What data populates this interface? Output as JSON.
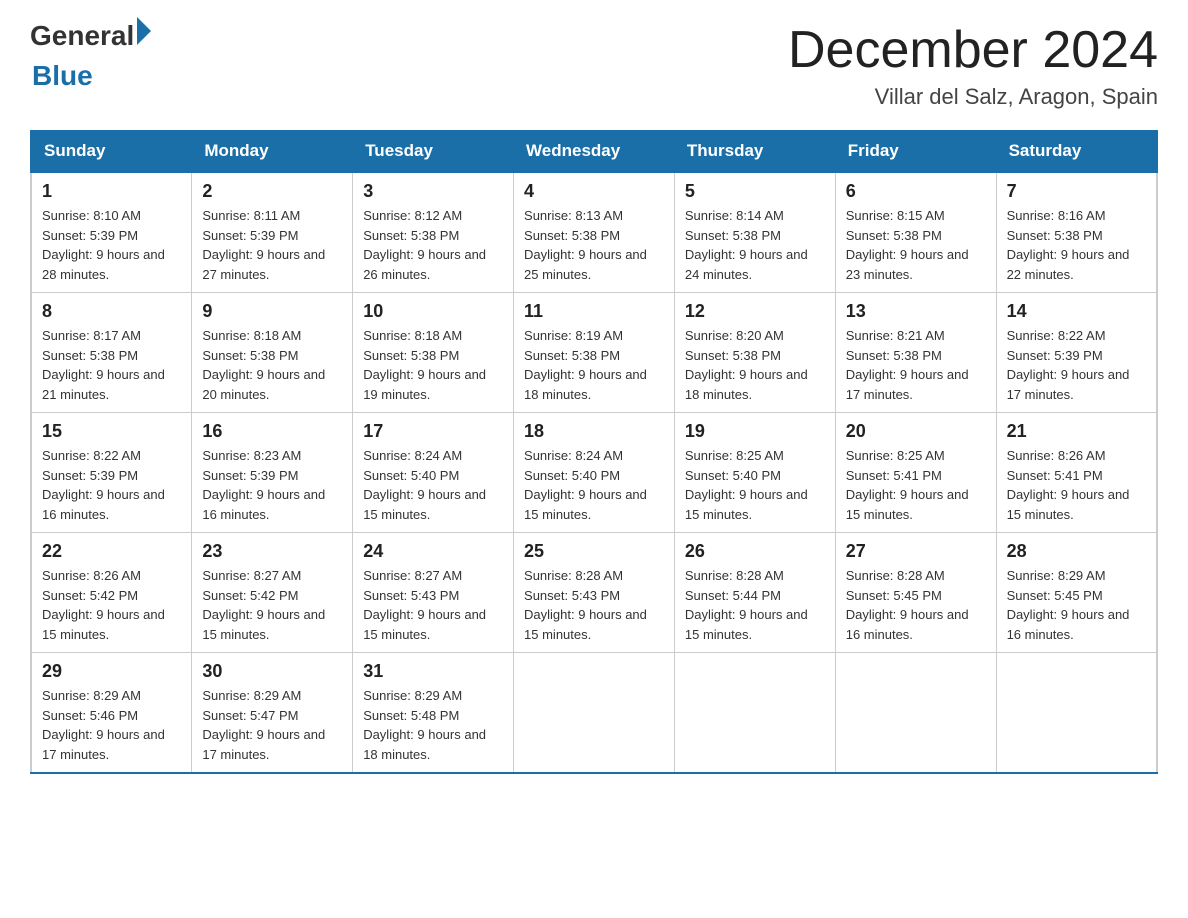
{
  "header": {
    "logo_general": "General",
    "logo_blue": "Blue",
    "title": "December 2024",
    "subtitle": "Villar del Salz, Aragon, Spain"
  },
  "days_of_week": [
    "Sunday",
    "Monday",
    "Tuesday",
    "Wednesday",
    "Thursday",
    "Friday",
    "Saturday"
  ],
  "weeks": [
    [
      {
        "day": "1",
        "sunrise": "8:10 AM",
        "sunset": "5:39 PM",
        "daylight": "9 hours and 28 minutes."
      },
      {
        "day": "2",
        "sunrise": "8:11 AM",
        "sunset": "5:39 PM",
        "daylight": "9 hours and 27 minutes."
      },
      {
        "day": "3",
        "sunrise": "8:12 AM",
        "sunset": "5:38 PM",
        "daylight": "9 hours and 26 minutes."
      },
      {
        "day": "4",
        "sunrise": "8:13 AM",
        "sunset": "5:38 PM",
        "daylight": "9 hours and 25 minutes."
      },
      {
        "day": "5",
        "sunrise": "8:14 AM",
        "sunset": "5:38 PM",
        "daylight": "9 hours and 24 minutes."
      },
      {
        "day": "6",
        "sunrise": "8:15 AM",
        "sunset": "5:38 PM",
        "daylight": "9 hours and 23 minutes."
      },
      {
        "day": "7",
        "sunrise": "8:16 AM",
        "sunset": "5:38 PM",
        "daylight": "9 hours and 22 minutes."
      }
    ],
    [
      {
        "day": "8",
        "sunrise": "8:17 AM",
        "sunset": "5:38 PM",
        "daylight": "9 hours and 21 minutes."
      },
      {
        "day": "9",
        "sunrise": "8:18 AM",
        "sunset": "5:38 PM",
        "daylight": "9 hours and 20 minutes."
      },
      {
        "day": "10",
        "sunrise": "8:18 AM",
        "sunset": "5:38 PM",
        "daylight": "9 hours and 19 minutes."
      },
      {
        "day": "11",
        "sunrise": "8:19 AM",
        "sunset": "5:38 PM",
        "daylight": "9 hours and 18 minutes."
      },
      {
        "day": "12",
        "sunrise": "8:20 AM",
        "sunset": "5:38 PM",
        "daylight": "9 hours and 18 minutes."
      },
      {
        "day": "13",
        "sunrise": "8:21 AM",
        "sunset": "5:38 PM",
        "daylight": "9 hours and 17 minutes."
      },
      {
        "day": "14",
        "sunrise": "8:22 AM",
        "sunset": "5:39 PM",
        "daylight": "9 hours and 17 minutes."
      }
    ],
    [
      {
        "day": "15",
        "sunrise": "8:22 AM",
        "sunset": "5:39 PM",
        "daylight": "9 hours and 16 minutes."
      },
      {
        "day": "16",
        "sunrise": "8:23 AM",
        "sunset": "5:39 PM",
        "daylight": "9 hours and 16 minutes."
      },
      {
        "day": "17",
        "sunrise": "8:24 AM",
        "sunset": "5:40 PM",
        "daylight": "9 hours and 15 minutes."
      },
      {
        "day": "18",
        "sunrise": "8:24 AM",
        "sunset": "5:40 PM",
        "daylight": "9 hours and 15 minutes."
      },
      {
        "day": "19",
        "sunrise": "8:25 AM",
        "sunset": "5:40 PM",
        "daylight": "9 hours and 15 minutes."
      },
      {
        "day": "20",
        "sunrise": "8:25 AM",
        "sunset": "5:41 PM",
        "daylight": "9 hours and 15 minutes."
      },
      {
        "day": "21",
        "sunrise": "8:26 AM",
        "sunset": "5:41 PM",
        "daylight": "9 hours and 15 minutes."
      }
    ],
    [
      {
        "day": "22",
        "sunrise": "8:26 AM",
        "sunset": "5:42 PM",
        "daylight": "9 hours and 15 minutes."
      },
      {
        "day": "23",
        "sunrise": "8:27 AM",
        "sunset": "5:42 PM",
        "daylight": "9 hours and 15 minutes."
      },
      {
        "day": "24",
        "sunrise": "8:27 AM",
        "sunset": "5:43 PM",
        "daylight": "9 hours and 15 minutes."
      },
      {
        "day": "25",
        "sunrise": "8:28 AM",
        "sunset": "5:43 PM",
        "daylight": "9 hours and 15 minutes."
      },
      {
        "day": "26",
        "sunrise": "8:28 AM",
        "sunset": "5:44 PM",
        "daylight": "9 hours and 15 minutes."
      },
      {
        "day": "27",
        "sunrise": "8:28 AM",
        "sunset": "5:45 PM",
        "daylight": "9 hours and 16 minutes."
      },
      {
        "day": "28",
        "sunrise": "8:29 AM",
        "sunset": "5:45 PM",
        "daylight": "9 hours and 16 minutes."
      }
    ],
    [
      {
        "day": "29",
        "sunrise": "8:29 AM",
        "sunset": "5:46 PM",
        "daylight": "9 hours and 17 minutes."
      },
      {
        "day": "30",
        "sunrise": "8:29 AM",
        "sunset": "5:47 PM",
        "daylight": "9 hours and 17 minutes."
      },
      {
        "day": "31",
        "sunrise": "8:29 AM",
        "sunset": "5:48 PM",
        "daylight": "9 hours and 18 minutes."
      },
      null,
      null,
      null,
      null
    ]
  ]
}
